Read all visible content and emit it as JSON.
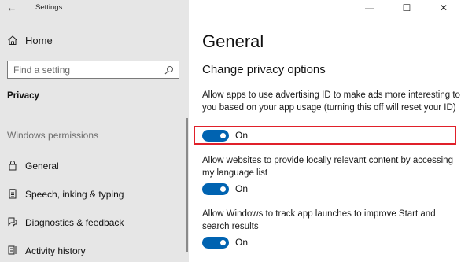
{
  "window": {
    "title": "Settings",
    "back_glyph": "←",
    "minimize_glyph": "—",
    "maximize_glyph": "☐",
    "close_glyph": "✕"
  },
  "sidebar": {
    "home_label": "Home",
    "search_placeholder": "Find a setting",
    "section_header": "Privacy",
    "sub_header": "Windows permissions",
    "items": [
      {
        "label": "General",
        "icon": "lock-icon"
      },
      {
        "label": "Speech, inking & typing",
        "icon": "notepad-icon"
      },
      {
        "label": "Diagnostics & feedback",
        "icon": "feedback-icon"
      },
      {
        "label": "Activity history",
        "icon": "activity-icon"
      }
    ]
  },
  "main": {
    "page_title": "General",
    "group_title": "Change privacy options",
    "settings": [
      {
        "description": "Allow apps to use advertising ID to make ads more interesting to you based on your app usage (turning this off will reset your ID)",
        "state_label": "On",
        "enabled": true
      },
      {
        "description": "Allow websites to provide locally relevant content by accessing my language list",
        "state_label": "On",
        "enabled": true
      },
      {
        "description": "Allow Windows to track app launches to improve Start and search results",
        "state_label": "On",
        "enabled": true
      }
    ]
  },
  "colors": {
    "accent": "#0063b1",
    "highlight": "#e0202a",
    "sidebar_bg": "#e6e6e6"
  }
}
